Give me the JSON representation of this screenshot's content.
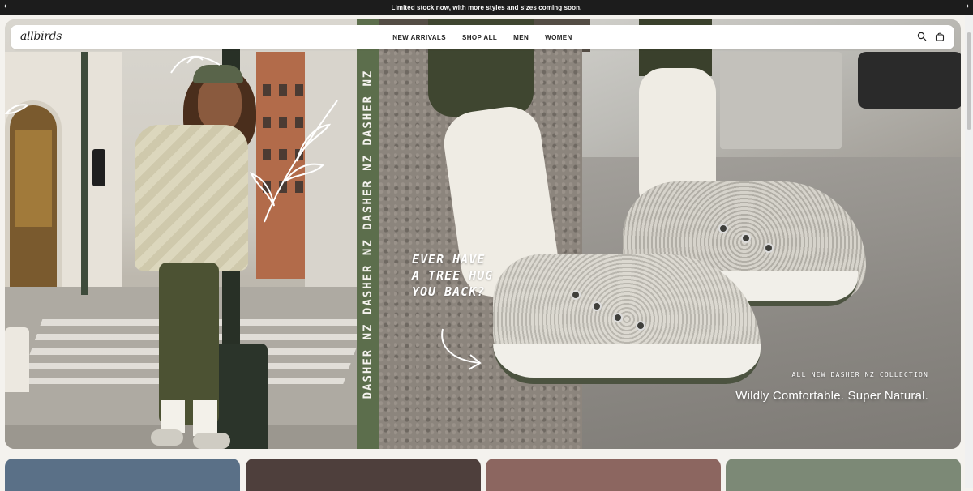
{
  "announcement": {
    "text": "Limited stock now, with more styles and sizes coming soon.",
    "prev_icon": "chevron-left-icon",
    "next_icon": "chevron-right-icon"
  },
  "header": {
    "logo": "allbirds",
    "nav": [
      "NEW ARRIVALS",
      "SHOP ALL",
      "MEN",
      "WOMEN"
    ],
    "icons": [
      "search-icon",
      "cart-icon"
    ]
  },
  "hero": {
    "strip_text": "DASHER NZ DASHER NZ DASHER NZ DASHER NZ",
    "tagline_lines": [
      "EVER HAVE",
      "A TREE HUG",
      "YOU BACK?"
    ],
    "collection_label": "ALL NEW DASHER NZ COLLECTION",
    "headline": "Wildly Comfortable. Super Natural."
  },
  "category_tiles": {
    "colors": [
      "#5a7087",
      "#4e3f3c",
      "#8c6660",
      "#7c8976"
    ]
  },
  "colors": {
    "announcement_bg": "#1c1c1c",
    "strip_green": "#5c6e4c",
    "page_bg": "#f4f2ee"
  }
}
